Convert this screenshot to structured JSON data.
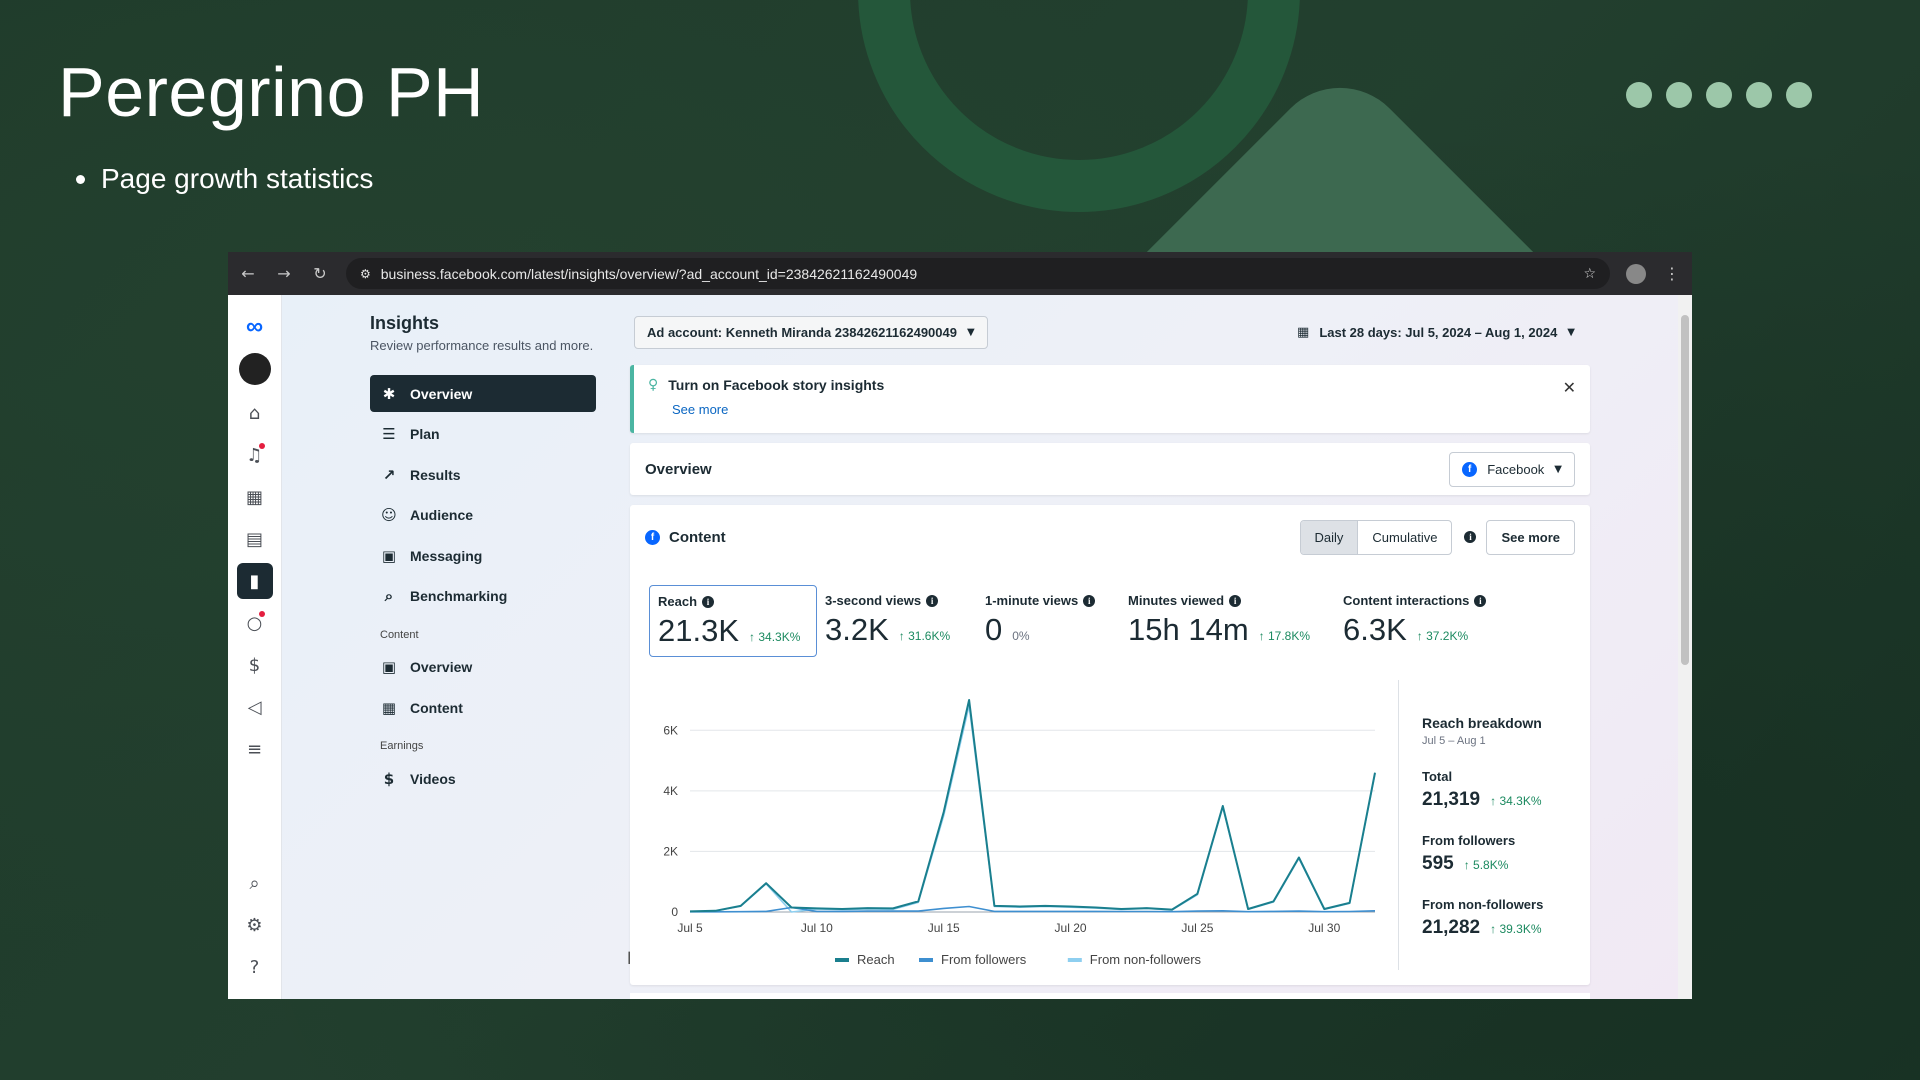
{
  "slide": {
    "title": "Peregrino PH",
    "bullet": "Page growth statistics"
  },
  "colors": {
    "background": "#1f3a2b",
    "accent_dots": "#9cc7a9",
    "ring": "#24573a",
    "brand": "#0866ff",
    "line": "#1a7f8e",
    "positive": "#1c8a60"
  },
  "browser": {
    "url": "business.facebook.com/latest/insights/overview/?ad_account_id=23842621162490049",
    "icons": [
      "back-icon",
      "forward-icon",
      "reload-icon",
      "site-info-icon",
      "star-icon",
      "profile-icon",
      "menu-icon"
    ]
  },
  "rail": {
    "icons": [
      "meta-logo",
      "avatar",
      "home-icon",
      "notifications-icon",
      "table-icon",
      "pages-icon",
      "insights-icon",
      "messages-icon",
      "money-icon",
      "megaphone-icon",
      "menu-icon",
      "search-icon",
      "settings-icon",
      "help-icon"
    ]
  },
  "insights": {
    "title": "Insights",
    "subtitle": "Review performance results and more.",
    "nav": [
      {
        "label": "Overview",
        "icon": "overview-icon"
      },
      {
        "label": "Plan",
        "icon": "plan-icon"
      },
      {
        "label": "Results",
        "icon": "results-icon"
      },
      {
        "label": "Audience",
        "icon": "audience-icon"
      },
      {
        "label": "Messaging",
        "icon": "messaging-icon"
      },
      {
        "label": "Benchmarking",
        "icon": "benchmarking-icon"
      }
    ],
    "content_section": "Content",
    "content_nav": [
      {
        "label": "Overview",
        "icon": "overview-icon"
      },
      {
        "label": "Content",
        "icon": "table-icon"
      }
    ],
    "earnings_section": "Earnings",
    "earnings_nav": [
      {
        "label": "Videos",
        "icon": "dollar-icon"
      }
    ]
  },
  "topbar": {
    "account": "Ad account: Kenneth Miranda 23842621162490049",
    "date_range": "Last 28 days: Jul 5, 2024 – Aug 1, 2024"
  },
  "banner": {
    "title": "Turn on Facebook story insights",
    "link": "See more"
  },
  "overview": {
    "title": "Overview",
    "platform": "Facebook"
  },
  "content": {
    "title": "Content",
    "toggle": [
      "Daily",
      "Cumulative"
    ],
    "see_more": "See more",
    "metrics": [
      {
        "label": "Reach",
        "value": "21.3K",
        "change": "↑ 34.3K%"
      },
      {
        "label": "3-second views",
        "value": "3.2K",
        "change": "↑ 31.6K%"
      },
      {
        "label": "1-minute views",
        "value": "0",
        "change": "0%"
      },
      {
        "label": "Minutes viewed",
        "value": "15h 14m",
        "change": "↑ 17.8K%"
      },
      {
        "label": "Content interactions",
        "value": "6.3K",
        "change": "↑ 37.2K%"
      }
    ]
  },
  "breakdown": {
    "title": "Reach breakdown",
    "range": "Jul 5 – Aug 1",
    "rows": [
      {
        "label": "Total",
        "value": "21,319",
        "change": "↑ 34.3K%"
      },
      {
        "label": "From followers",
        "value": "595",
        "change": "↑ 5.8K%"
      },
      {
        "label": "From non-followers",
        "value": "21,282",
        "change": "↑ 39.3K%"
      }
    ]
  },
  "chart_data": {
    "type": "line",
    "x": [
      "Jul 5",
      "Jul 6",
      "Jul 7",
      "Jul 8",
      "Jul 9",
      "Jul 10",
      "Jul 11",
      "Jul 12",
      "Jul 13",
      "Jul 14",
      "Jul 15",
      "Jul 16",
      "Jul 17",
      "Jul 18",
      "Jul 19",
      "Jul 20",
      "Jul 21",
      "Jul 22",
      "Jul 23",
      "Jul 24",
      "Jul 25",
      "Jul 26",
      "Jul 27",
      "Jul 28",
      "Jul 29",
      "Jul 30",
      "Jul 31",
      "Aug 1"
    ],
    "xticks": [
      "Jul 5",
      "Jul 10",
      "Jul 15",
      "Jul 20",
      "Jul 25",
      "Jul 30"
    ],
    "yticks": [
      "0",
      "2K",
      "4K",
      "6K"
    ],
    "ylim": [
      0,
      7000
    ],
    "series": [
      {
        "name": "Reach",
        "color": "#1a7f8e",
        "values": [
          20,
          40,
          200,
          950,
          150,
          120,
          100,
          130,
          120,
          350,
          3300,
          7000,
          200,
          180,
          200,
          180,
          150,
          100,
          130,
          80,
          600,
          3500,
          100,
          350,
          1800,
          100,
          300,
          4600
        ]
      },
      {
        "name": "From followers",
        "color": "#3e8fd0",
        "values": [
          5,
          8,
          10,
          20,
          150,
          20,
          20,
          30,
          30,
          30,
          120,
          180,
          20,
          20,
          20,
          20,
          20,
          15,
          15,
          10,
          30,
          40,
          10,
          20,
          30,
          10,
          15,
          40
        ]
      },
      {
        "name": "From non-followers",
        "color": "#8ecff0",
        "values": [
          15,
          32,
          190,
          930,
          0,
          100,
          80,
          100,
          90,
          320,
          3180,
          6820,
          180,
          160,
          180,
          160,
          130,
          85,
          115,
          70,
          570,
          3460,
          90,
          330,
          1770,
          90,
          285,
          4560
        ]
      }
    ],
    "legend_position": "bottom",
    "grid": true
  }
}
